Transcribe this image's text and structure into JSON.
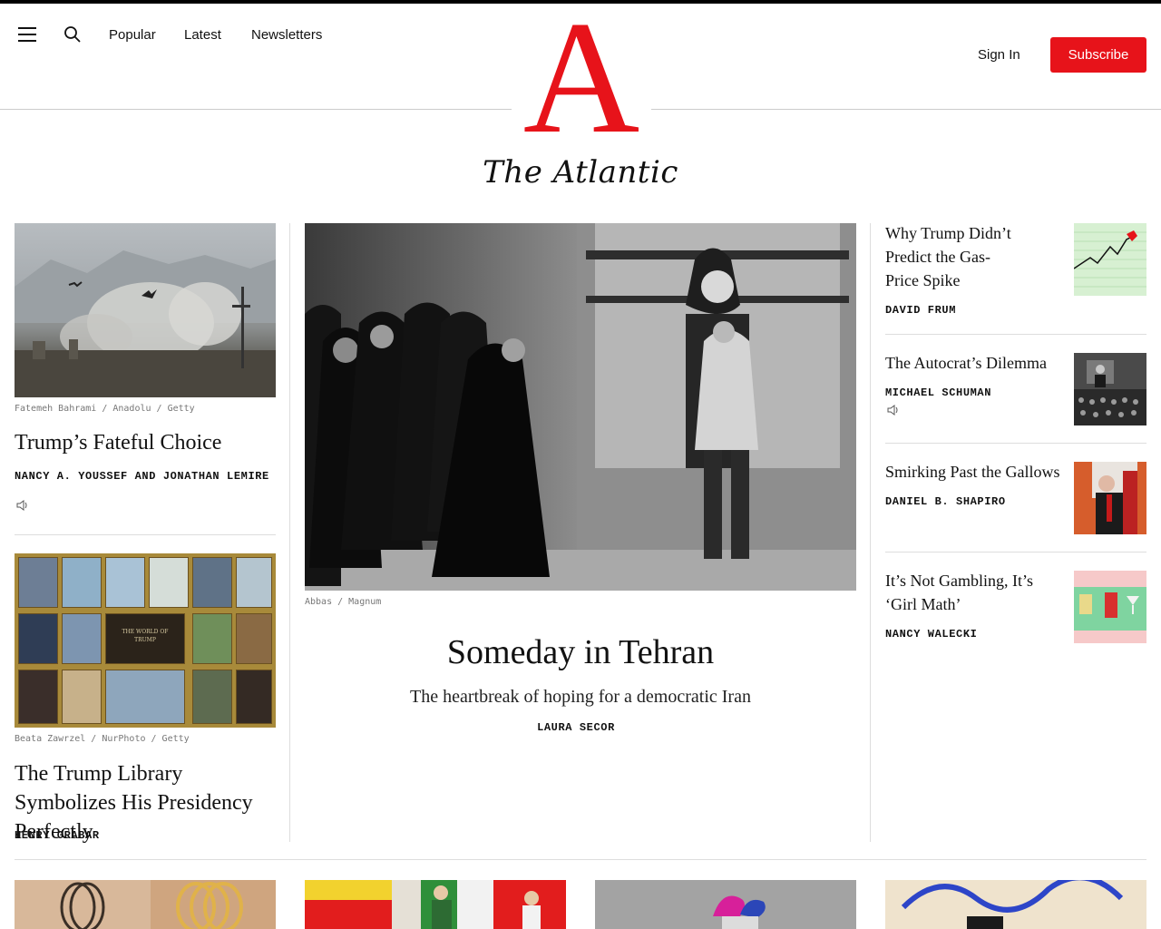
{
  "header": {
    "nav": [
      "Popular",
      "Latest",
      "Newsletters"
    ],
    "logo_letter": "A",
    "logo_word": "The Atlantic",
    "sign_in": "Sign In",
    "subscribe": "Subscribe"
  },
  "left": {
    "story1": {
      "credit": "Fatemeh Bahrami / Anadolu / Getty",
      "title": "Trump’s Fateful Choice",
      "byline": "NANCY A. YOUSSEF AND JONATHAN LEMIRE"
    },
    "story2": {
      "credit": "Beata Zawrzel / NurPhoto / Getty",
      "title": "The Trump Library Symbolizes His Presidency Perfectly",
      "byline": "HENRY GRABAR",
      "image_caption": "THE WORLD OF TRUMP"
    }
  },
  "hero": {
    "credit": "Abbas / Magnum",
    "title": "Someday in Tehran",
    "dek": "The heartbreak of hoping for a democratic Iran",
    "byline": "LAURA SECOR"
  },
  "right": [
    {
      "title": "Why Trump Didn’t Predict the Gas-Price Spike",
      "byline": "DAVID FRUM",
      "audio": false
    },
    {
      "title": "The Autocrat’s Dilemma",
      "byline": "MICHAEL SCHUMAN",
      "audio": true
    },
    {
      "title": "Smirking Past the Gallows",
      "byline": "DANIEL B. SHAPIRO",
      "audio": false
    },
    {
      "title": "It’s Not Gambling, It’s ‘Girl Math’",
      "byline": "NANCY WALECKI",
      "audio": false
    }
  ],
  "colors": {
    "brand_red": "#e7131a"
  }
}
